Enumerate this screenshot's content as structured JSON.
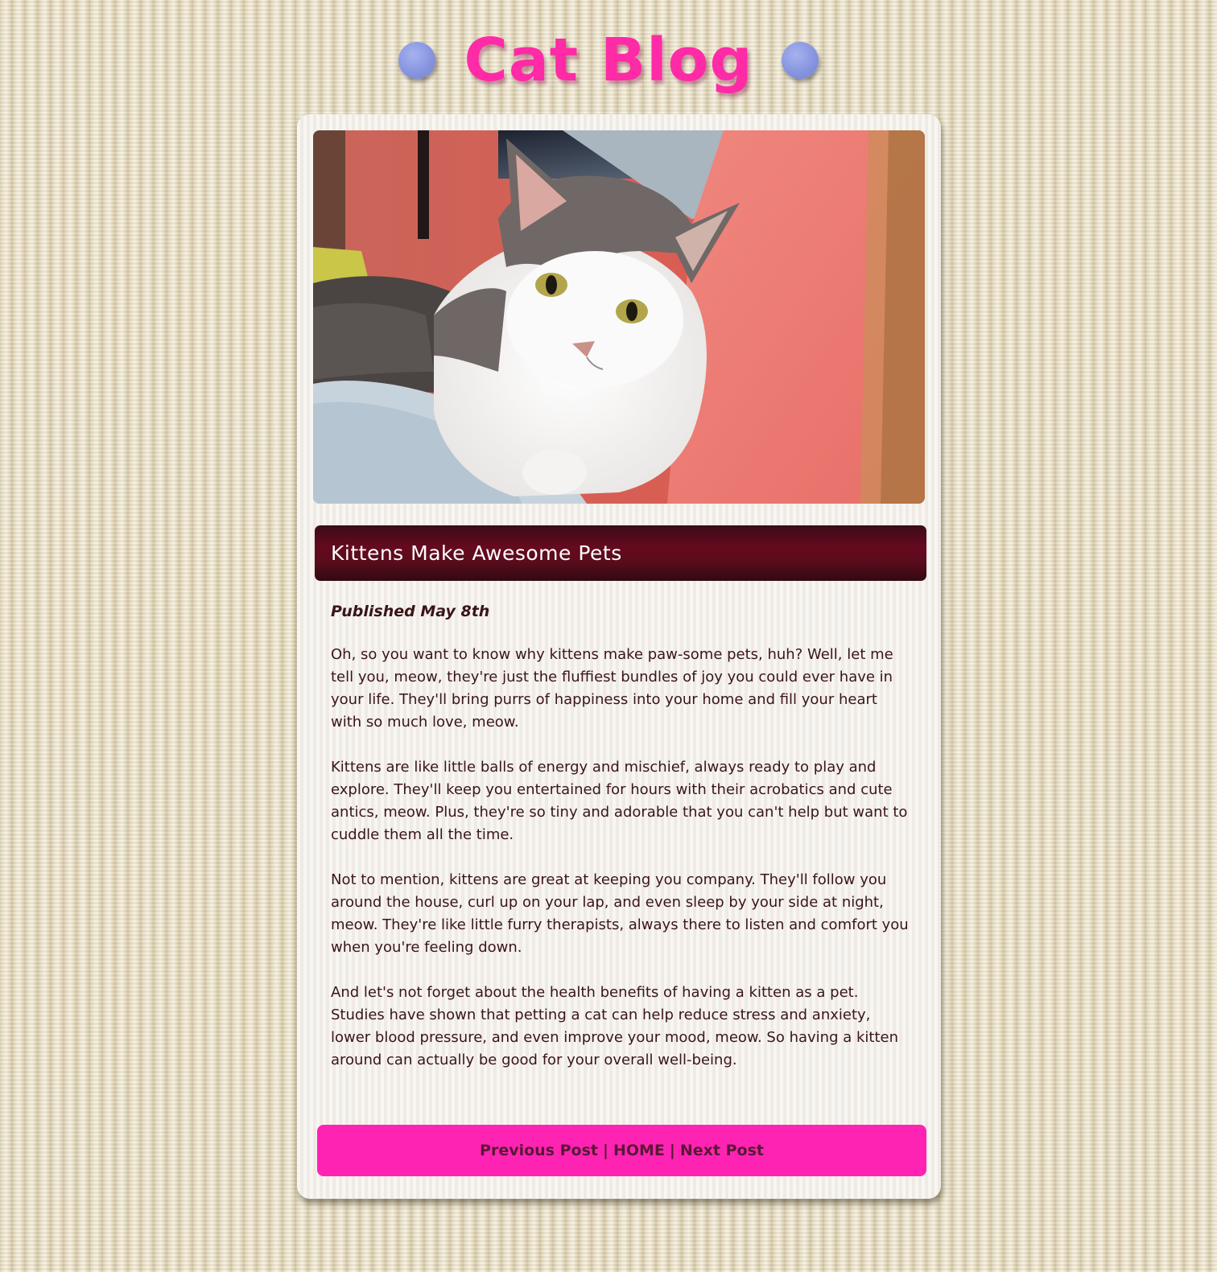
{
  "header": {
    "site_title": "Cat Blog"
  },
  "post": {
    "title": "Kittens Make Awesome Pets",
    "published": "Published May 8th",
    "paragraphs": [
      "Oh, so you want to know why kittens make paw-some pets, huh? Well, let me tell you, meow, they're just the fluffiest bundles of joy you could ever have in your life. They'll bring purrs of happiness into your home and fill your heart with so much love, meow.",
      "Kittens are like little balls of energy and mischief, always ready to play and explore. They'll keep you entertained for hours with their acrobatics and cute antics, meow. Plus, they're so tiny and adorable that you can't help but want to cuddle them all the time.",
      "Not to mention, kittens are great at keeping you company. They'll follow you around the house, curl up on your lap, and even sleep by your side at night, meow. They're like little furry therapists, always there to listen and comfort you when you're feeling down.",
      "And let's not forget about the health benefits of having a kitten as a pet. Studies have shown that petting a cat can help reduce stress and anxiety, lower blood pressure, and even improve your mood, meow. So having a kitten around can actually be good for your overall well-being."
    ]
  },
  "nav": {
    "previous_label": "Previous Post",
    "home_label": "HOME",
    "next_label": "Next Post",
    "separator": "|"
  },
  "colors": {
    "title_pink": "#ff2aa6",
    "title_bar_maroon": "#5a0c1c",
    "nav_bar_pink": "#ff23b4",
    "dot_blue": "#8795e0",
    "text_dark": "#3a1518"
  },
  "icons": {
    "header_dots": "circle-decoration-icon",
    "photo": "cat-photo"
  }
}
